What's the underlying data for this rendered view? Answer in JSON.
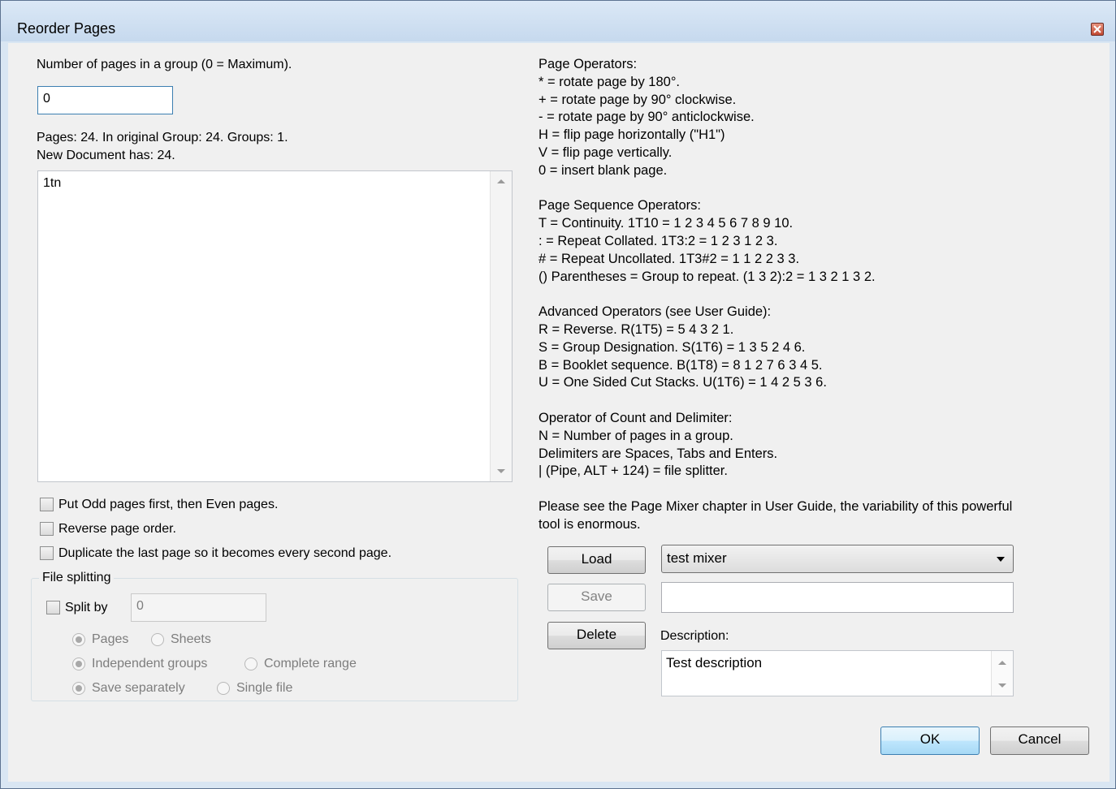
{
  "window": {
    "title": "Reorder Pages"
  },
  "left": {
    "group_count_label": "Number of pages in a group (0 = Maximum).",
    "group_count_value": "0",
    "info_line1": "Pages: 24. In original Group: 24. Groups: 1.",
    "info_line2": "New Document has: 24.",
    "sequence_text": "1tn",
    "checkboxes": [
      {
        "label": "Put Odd pages first, then Even pages.",
        "checked": false
      },
      {
        "label": "Reverse page order.",
        "checked": false
      },
      {
        "label": "Duplicate the last page so it becomes every second page.",
        "checked": false
      }
    ],
    "file_splitting": {
      "title": "File splitting",
      "split_by_label": "Split by",
      "split_by_value": "0",
      "radios": {
        "pages": "Pages",
        "sheets": "Sheets",
        "independent_groups": "Independent groups",
        "complete_range": "Complete range",
        "save_separately": "Save separately",
        "single_file": "Single file"
      }
    }
  },
  "help": {
    "lines": [
      "Page Operators:",
      "* = rotate page by 180°.",
      "+ = rotate page by 90° clockwise.",
      "- = rotate page by 90° anticlockwise.",
      "H = flip page horizontally (\"H1\")",
      "V = flip page vertically.",
      "0 = insert blank page.",
      "",
      "Page Sequence Operators:",
      "T = Continuity.  1T10 = 1 2 3 4 5 6 7 8 9 10.",
      ": = Repeat Collated.  1T3:2 = 1 2 3 1 2 3.",
      "# = Repeat Uncollated.  1T3#2 = 1 1 2 2 3 3.",
      "() Parentheses = Group to repeat. (1 3 2):2 = 1 3 2 1 3 2.",
      "",
      "Advanced Operators (see User Guide):",
      "R = Reverse. R(1T5) = 5 4 3 2 1.",
      "S = Group Designation. S(1T6) = 1 3 5 2 4 6.",
      "B = Booklet sequence. B(1T8) = 8 1 2 7 6 3 4 5.",
      "U = One Sided Cut Stacks. U(1T6) = 1 4 2 5 3 6.",
      "",
      "Operator of Count and Delimiter:",
      "N = Number of pages in a group.",
      "Delimiters are Spaces, Tabs and Enters.",
      "| (Pipe, ALT + 124) = file splitter.",
      "",
      "Please see the Page Mixer chapter in User Guide, the variability of this powerful",
      "tool is enormous."
    ]
  },
  "mixer": {
    "load_label": "Load",
    "save_label": "Save",
    "delete_label": "Delete",
    "selected_mixer": "test mixer",
    "name_value": "",
    "description_label": "Description:",
    "description_value": "Test description"
  },
  "footer": {
    "ok_label": "OK",
    "cancel_label": "Cancel"
  },
  "colors": {
    "window_frame": "#d9e6f3",
    "client_bg": "#f0f0f0",
    "default_button": "#bee6fd"
  }
}
